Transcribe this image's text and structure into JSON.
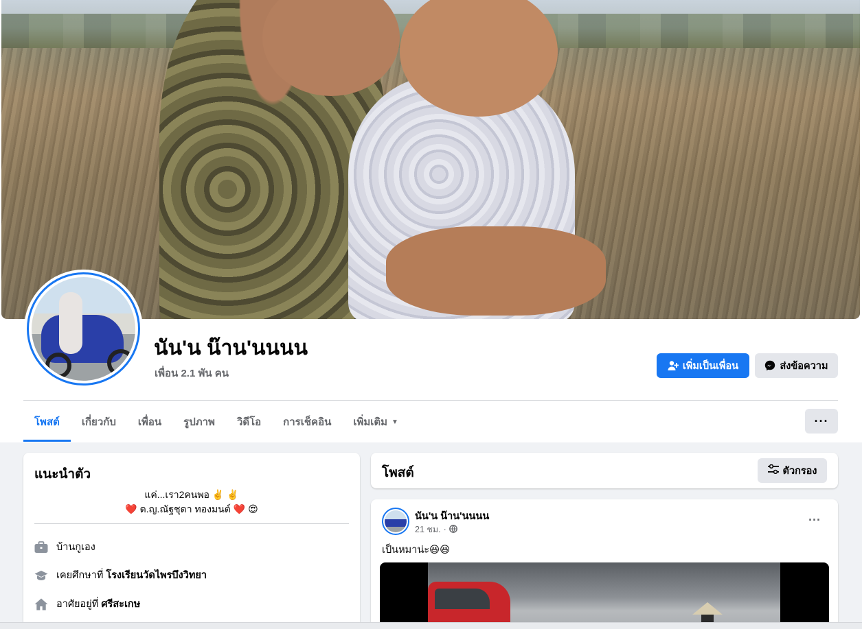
{
  "profile": {
    "name": "นัน'น น๊าน'นนนน",
    "friends": "เพื่อน 2.1 พัน คน"
  },
  "actions": {
    "add_friend": "เพิ่มเป็นเพื่อน",
    "message": "ส่งข้อความ"
  },
  "tabs": [
    {
      "label": "โพสต์",
      "active": true
    },
    {
      "label": "เกี่ยวกับ"
    },
    {
      "label": "เพื่อน"
    },
    {
      "label": "รูปภาพ"
    },
    {
      "label": "วิดีโอ"
    },
    {
      "label": "การเช็คอิน"
    },
    {
      "label": "เพิ่มเติม"
    }
  ],
  "tab_more_icon": "ellipsis-icon",
  "intro": {
    "title": "แนะนำตัว",
    "bio_line1": "แค่...เรา2คนพอ ✌️ ✌️",
    "bio_line2": "❤️ ด.ญ.ณัฐชุดา ทองมนต์ ❤️ 😍",
    "work": "บ้านกูเอง",
    "education_prefix": "เคยศึกษาที่",
    "education_school": "โรงเรียนวัดไพรบึงวิทยา",
    "lives_prefix": "อาศัยอยู่ที่",
    "lives_place": "ศรีสะเกษ"
  },
  "posts_header": {
    "title": "โพสต์",
    "filter": "ตัวกรอง"
  },
  "post": {
    "author": "นัน'น น๊าน'นนนน",
    "time": "21 ชม.",
    "separator": "·",
    "text": "เป็นหมาน่ะ😆😆"
  },
  "colors": {
    "accent": "#1877f2",
    "background": "#f0f2f5",
    "secondary_button": "#e4e6eb",
    "muted_text": "#65676b"
  }
}
